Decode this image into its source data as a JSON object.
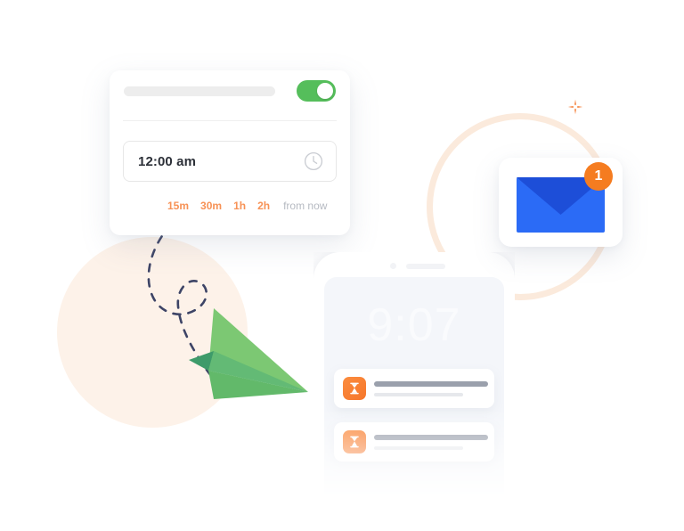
{
  "scheduler_card": {
    "toggle": {
      "state": "on",
      "color": "#55BE5B"
    },
    "placeholder_bar": {
      "label": ""
    },
    "time_field": {
      "value": "12:00 am",
      "placeholder": "12:00 am",
      "icon": "clock-icon"
    },
    "quick_options": [
      {
        "label": "15m"
      },
      {
        "label": "30m"
      },
      {
        "label": "1h"
      },
      {
        "label": "2h"
      }
    ],
    "quick_suffix": "from now",
    "accent_color": "#F79256"
  },
  "phone": {
    "clock": "9:07",
    "screen_color": "#F4F6FA",
    "notifications": [
      {
        "icon": "hourglass-icon",
        "title": "",
        "subtitle": ""
      },
      {
        "icon": "hourglass-icon",
        "title": "",
        "subtitle": ""
      }
    ]
  },
  "mail_bubble": {
    "badge_count": "1",
    "badge_color": "#F57C20",
    "envelope_color": "#2B6BF6",
    "envelope_flap_color": "#1D4ED8",
    "icon": "envelope-icon"
  },
  "decor": {
    "cream_circle": {
      "color": "#FDF2E9"
    },
    "cream_ring": {
      "color": "#FBEADC"
    },
    "sparkle": {
      "color": "#F79256",
      "icon": "sparkle-plus-icon"
    },
    "flight_path": {
      "color": "#3D4466",
      "icon": "dashed-flight-path"
    },
    "paper_plane": {
      "light": "#7CC873",
      "mid": "#62B96A",
      "dark": "#3E9B6A",
      "icon": "paper-plane-icon"
    }
  }
}
